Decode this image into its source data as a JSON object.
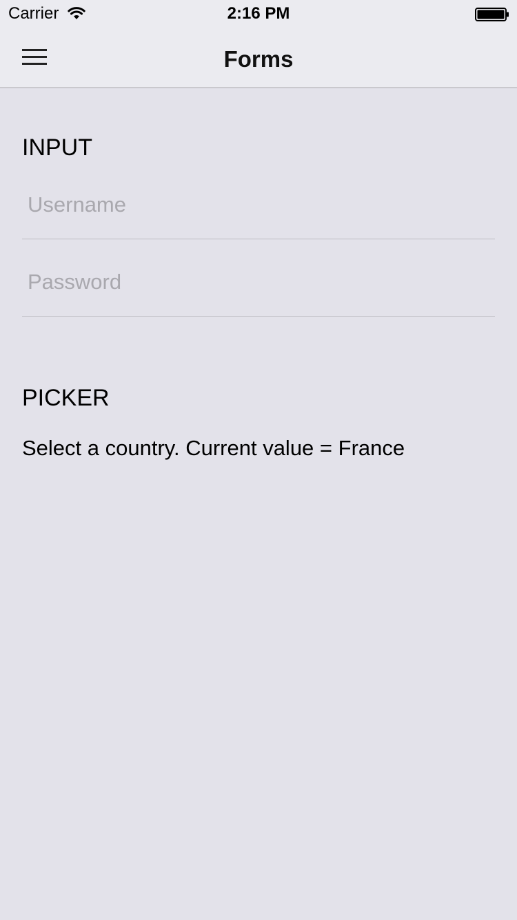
{
  "status_bar": {
    "carrier": "Carrier",
    "time": "2:16 PM",
    "wifi_icon": "wifi-icon",
    "battery_icon": "battery-icon"
  },
  "nav": {
    "menu_icon": "hamburger-menu-icon",
    "title": "Forms"
  },
  "input_section": {
    "title": "INPUT",
    "username": {
      "placeholder": "Username",
      "value": ""
    },
    "password": {
      "placeholder": "Password",
      "value": ""
    }
  },
  "picker_section": {
    "title": "PICKER",
    "text": "Select a country. Current value = France"
  },
  "colors": {
    "background": "#e3e2ea",
    "nav_background": "#ebebf0",
    "placeholder": "#a9a8ae",
    "divider": "#bdbcc2"
  }
}
